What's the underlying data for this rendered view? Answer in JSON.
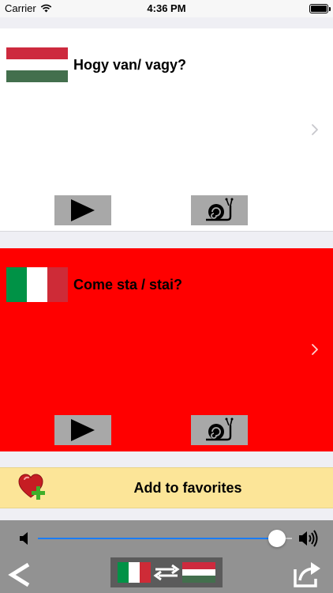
{
  "status_bar": {
    "carrier": "Carrier",
    "time": "4:36 PM"
  },
  "cards": [
    {
      "language": "Hungarian",
      "phrase": "Hogy van/ vagy?",
      "background": "#ffffff",
      "flag_colors": [
        "#cd2a3e",
        "#ffffff",
        "#436f4d"
      ]
    },
    {
      "language": "Italian",
      "phrase": "Come sta / stai?",
      "background": "#ff0000",
      "flag_colors": [
        "#009246",
        "#ffffff",
        "#ce2b37"
      ]
    }
  ],
  "favorites": {
    "label": "Add to favorites",
    "icon": "heart-plus-icon"
  },
  "toolbar": {
    "volume_level": 0.94,
    "accent": "#1a7cf5",
    "icons": [
      "speaker-low-icon",
      "speaker-high-icon",
      "back-icon",
      "swap-languages-icon",
      "share-icon"
    ]
  }
}
